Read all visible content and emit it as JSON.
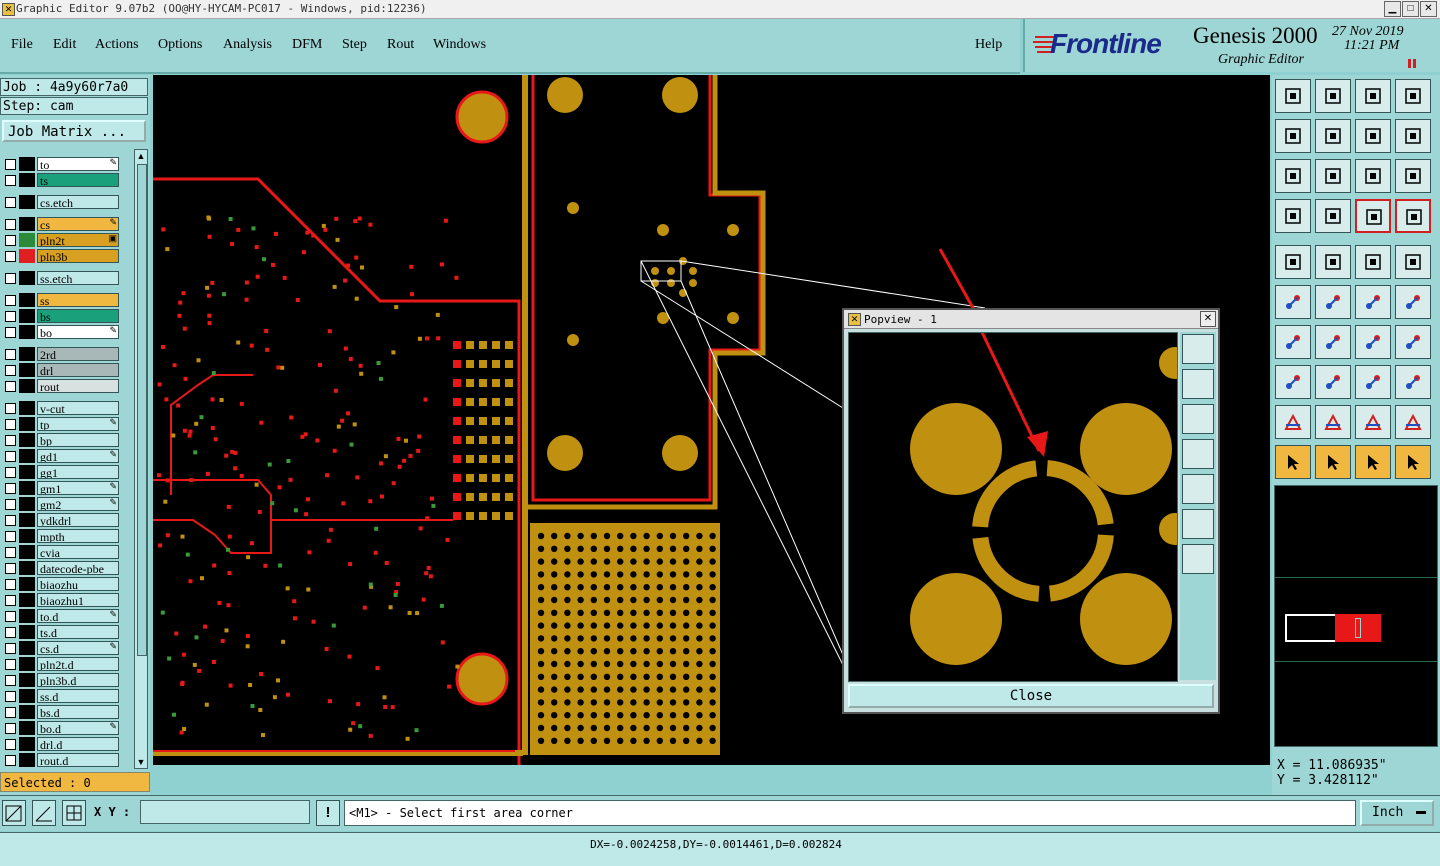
{
  "window": {
    "title": "Graphic Editor 9.07b2 (OO@HY-HYCAM-PC017 - Windows, pid:12236)"
  },
  "menu": {
    "file": "File",
    "edit": "Edit",
    "actions": "Actions",
    "options": "Options",
    "analysis": "Analysis",
    "dfm": "DFM",
    "step": "Step",
    "rout": "Rout",
    "windows": "Windows",
    "help": "Help"
  },
  "brand": {
    "logo": "Frontline",
    "product": "Genesis 2000",
    "subtitle": "Graphic Editor",
    "date": "27 Nov 2019",
    "time": "11:21 PM"
  },
  "job": {
    "job_label": "Job : 4a9y60r7a0",
    "step_label": "Step: cam",
    "matrix_button": "Job Matrix ..."
  },
  "layers": [
    {
      "name": "to",
      "bg": "#ffffff",
      "sw": "#000000",
      "mark": "✎"
    },
    {
      "name": "ts",
      "bg": "#1aa07a",
      "sw": "#000000",
      "mark": ""
    },
    {
      "name": "cs.etch",
      "bg": "#bfe8e8",
      "sw": "#000000",
      "mark": ""
    },
    {
      "name": "cs",
      "bg": "#f0b840",
      "sw": "#000000",
      "mark": "✎"
    },
    {
      "name": "pln2t",
      "bg": "#d8a020",
      "sw": "#2a8a3a",
      "mark": "▣"
    },
    {
      "name": "pln3b",
      "bg": "#d8a020",
      "sw": "#e02020",
      "mark": ""
    },
    {
      "name": "ss.etch",
      "bg": "#bfe8e8",
      "sw": "#000000",
      "mark": ""
    },
    {
      "name": "ss",
      "bg": "#f0b840",
      "sw": "#000000",
      "mark": ""
    },
    {
      "name": "bs",
      "bg": "#1aa07a",
      "sw": "#000000",
      "mark": ""
    },
    {
      "name": "bo",
      "bg": "#ffffff",
      "sw": "#000000",
      "mark": "✎"
    },
    {
      "name": "2rd",
      "bg": "#a8b8b8",
      "sw": "#000000",
      "mark": ""
    },
    {
      "name": "drl",
      "bg": "#a8b8b8",
      "sw": "#000000",
      "mark": ""
    },
    {
      "name": "rout",
      "bg": "#d8e0e0",
      "sw": "#000000",
      "mark": ""
    },
    {
      "name": "v-cut",
      "bg": "#bfe8e8",
      "sw": "#000000",
      "mark": ""
    },
    {
      "name": "tp",
      "bg": "#bfe8e8",
      "sw": "#000000",
      "mark": "✎"
    },
    {
      "name": "bp",
      "bg": "#bfe8e8",
      "sw": "#000000",
      "mark": ""
    },
    {
      "name": "gd1",
      "bg": "#bfe8e8",
      "sw": "#000000",
      "mark": "✎"
    },
    {
      "name": "gg1",
      "bg": "#bfe8e8",
      "sw": "#000000",
      "mark": ""
    },
    {
      "name": "gm1",
      "bg": "#bfe8e8",
      "sw": "#000000",
      "mark": "✎"
    },
    {
      "name": "gm2",
      "bg": "#bfe8e8",
      "sw": "#000000",
      "mark": "✎"
    },
    {
      "name": "ydkdrl",
      "bg": "#bfe8e8",
      "sw": "#000000",
      "mark": ""
    },
    {
      "name": "mpth",
      "bg": "#bfe8e8",
      "sw": "#000000",
      "mark": ""
    },
    {
      "name": "cvia",
      "bg": "#bfe8e8",
      "sw": "#000000",
      "mark": ""
    },
    {
      "name": "datecode-pbe",
      "bg": "#bfe8e8",
      "sw": "#000000",
      "mark": ""
    },
    {
      "name": "biaozhu",
      "bg": "#bfe8e8",
      "sw": "#000000",
      "mark": ""
    },
    {
      "name": "biaozhu1",
      "bg": "#bfe8e8",
      "sw": "#000000",
      "mark": ""
    },
    {
      "name": "to.d",
      "bg": "#bfe8e8",
      "sw": "#000000",
      "mark": "✎"
    },
    {
      "name": "ts.d",
      "bg": "#bfe8e8",
      "sw": "#000000",
      "mark": ""
    },
    {
      "name": "cs.d",
      "bg": "#bfe8e8",
      "sw": "#000000",
      "mark": "✎"
    },
    {
      "name": "pln2t.d",
      "bg": "#bfe8e8",
      "sw": "#000000",
      "mark": ""
    },
    {
      "name": "pln3b.d",
      "bg": "#bfe8e8",
      "sw": "#000000",
      "mark": ""
    },
    {
      "name": "ss.d",
      "bg": "#bfe8e8",
      "sw": "#000000",
      "mark": ""
    },
    {
      "name": "bs.d",
      "bg": "#bfe8e8",
      "sw": "#000000",
      "mark": ""
    },
    {
      "name": "bo.d",
      "bg": "#bfe8e8",
      "sw": "#000000",
      "mark": "✎"
    },
    {
      "name": "drl.d",
      "bg": "#bfe8e8",
      "sw": "#000000",
      "mark": ""
    },
    {
      "name": "rout.d",
      "bg": "#bfe8e8",
      "sw": "#000000",
      "mark": ""
    }
  ],
  "selected": {
    "label": "Selected : 0"
  },
  "popview": {
    "title": "Popview - 1",
    "close_label": "Close"
  },
  "coords": {
    "x": "X = 11.086935\"",
    "y": "Y = 3.428112\""
  },
  "prompt": {
    "xy_label": "X Y :",
    "xy_value": "",
    "message": "<M1> - Select first area corner",
    "units": "Inch"
  },
  "status": {
    "text": "DX=-0.0024258,DY=-0.0014461,D=0.002824"
  },
  "colors": {
    "copper": "#c09010",
    "trace": "#e81818",
    "panel": "#9ed6d6"
  }
}
